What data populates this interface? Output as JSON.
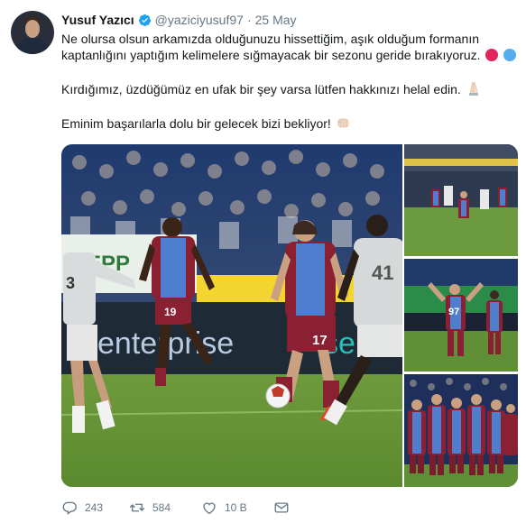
{
  "author": {
    "display_name": "Yusuf Yazıcı",
    "handle": "@yaziciyusuf97",
    "separator": "·",
    "date": "25 May"
  },
  "tweet": {
    "line1": "Ne olursa olsun arkamızda olduğunuzu hissettiğim, aşık olduğum formanın",
    "line2": "kaptanlığını yaptığım kelimelere sığmayacak bir sezonu geride bırakıyoruz.",
    "line3": "Kırdığımız, üzdüğümüz en ufak bir şey varsa lütfen hakkınızı helal edin.",
    "line4": "Eminim başarılarla dolu bir gelecek bizi bekliyor!",
    "emoji_colors": {
      "red": "#e0245e",
      "blue": "#55acee"
    }
  },
  "media": {
    "main_shirt_number": "17",
    "left_player_number": "19",
    "right_player_number": "41",
    "sponsor_text": "enterprise",
    "sponsor_text2": "se",
    "photo2_number": "97"
  },
  "actions": {
    "replies": "243",
    "retweets": "584",
    "likes": "10 B"
  },
  "icons": [
    "verified-icon",
    "reply-icon",
    "retweet-icon",
    "like-icon",
    "message-icon",
    "folded-hands-icon",
    "fist-icon"
  ]
}
